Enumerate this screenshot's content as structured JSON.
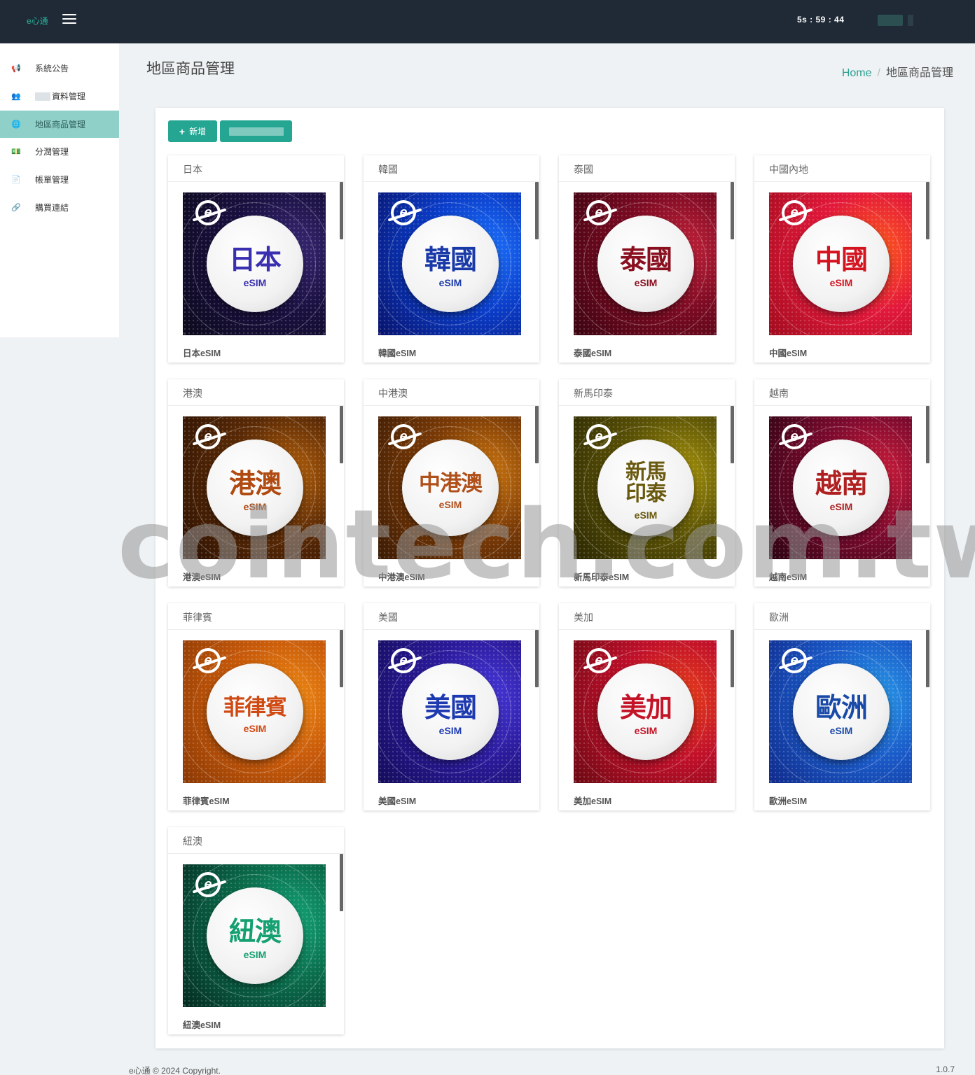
{
  "topbar": {
    "brand": "e心通",
    "timer": "5s : 59 : 44"
  },
  "sidebar": {
    "items": [
      {
        "label": "系統公告",
        "icon": "megaphone-icon",
        "glyph": "📢"
      },
      {
        "label": "資料管理",
        "icon": "users-icon",
        "glyph": "👥"
      },
      {
        "label": "地區商品管理",
        "icon": "globe-icon",
        "glyph": "🌐"
      },
      {
        "label": "分潤管理",
        "icon": "money-icon",
        "glyph": "💵"
      },
      {
        "label": "帳單管理",
        "icon": "document-icon",
        "glyph": "📄"
      },
      {
        "label": "購買連結",
        "icon": "link-icon",
        "glyph": "🔗"
      }
    ]
  },
  "header": {
    "title": "地區商品管理",
    "breadcrumb_home": "Home",
    "breadcrumb_current": "地區商品管理"
  },
  "toolbar": {
    "add_label": "新增"
  },
  "cards": [
    {
      "title": "日本",
      "product": "日本eSIM",
      "art_text": "日本",
      "colors": [
        "#1a1040",
        "#3b2a7a",
        "#0c0a1c"
      ],
      "text_color": "#3a2fb0"
    },
    {
      "title": "韓國",
      "product": "韓國eSIM",
      "art_text": "韓國",
      "colors": [
        "#0a3cc8",
        "#1e74ff",
        "#08126a"
      ],
      "text_color": "#1a3aa8"
    },
    {
      "title": "泰國",
      "product": "泰國eSIM",
      "art_text": "泰國",
      "colors": [
        "#7a0a22",
        "#c8243c",
        "#3a0410"
      ],
      "text_color": "#8a1020"
    },
    {
      "title": "中國內地",
      "product": "中國eSIM",
      "art_text": "中國",
      "colors": [
        "#e2183a",
        "#ff5a1e",
        "#a00c1e"
      ],
      "text_color": "#d41420"
    },
    {
      "title": "港澳",
      "product": "港澳eSIM",
      "art_text": "港澳",
      "colors": [
        "#5a2a06",
        "#b8620a",
        "#2a1002"
      ],
      "text_color": "#b04a10"
    },
    {
      "title": "中港澳",
      "product": "中港澳eSIM",
      "art_text": "中港澳",
      "colors": [
        "#7a3a06",
        "#d27a10",
        "#3a1a04"
      ],
      "text_color": "#b0501a"
    },
    {
      "title": "新馬印泰",
      "product": "新馬印泰eSIM",
      "art_text": "新馬印泰",
      "colors": [
        "#5a5206",
        "#a8940c",
        "#2a2602"
      ],
      "text_color": "#6a5a10"
    },
    {
      "title": "越南",
      "product": "越南eSIM",
      "art_text": "越南",
      "colors": [
        "#7a0a2e",
        "#d41e3c",
        "#2a0410"
      ],
      "text_color": "#b02020"
    },
    {
      "title": "菲律賓",
      "product": "菲律賓eSIM",
      "art_text": "菲律賓",
      "colors": [
        "#c85a0a",
        "#f08a14",
        "#8a3804"
      ],
      "text_color": "#d04a14"
    },
    {
      "title": "美國",
      "product": "美國eSIM",
      "art_text": "美國",
      "colors": [
        "#2a1a9a",
        "#4a3ae0",
        "#140c5a"
      ],
      "text_color": "#1e3ab0"
    },
    {
      "title": "美加",
      "product": "美加eSIM",
      "art_text": "美加",
      "colors": [
        "#c0102a",
        "#e8401a",
        "#6a0812"
      ],
      "text_color": "#c41428"
    },
    {
      "title": "歐洲",
      "product": "歐洲eSIM",
      "art_text": "歐洲",
      "colors": [
        "#1a5ac8",
        "#2a9ae8",
        "#102a8a"
      ],
      "text_color": "#1a4aa8"
    },
    {
      "title": "紐澳",
      "product": "紐澳eSIM",
      "art_text": "紐澳",
      "colors": [
        "#0a6a4a",
        "#14a878",
        "#042a20"
      ],
      "text_color": "#14a070"
    }
  ],
  "art_subtext": "eSIM",
  "watermark": "cointech.com.tw",
  "footer": {
    "copyright": "e心通 © 2024 Copyright.",
    "version": "1.0.7"
  }
}
